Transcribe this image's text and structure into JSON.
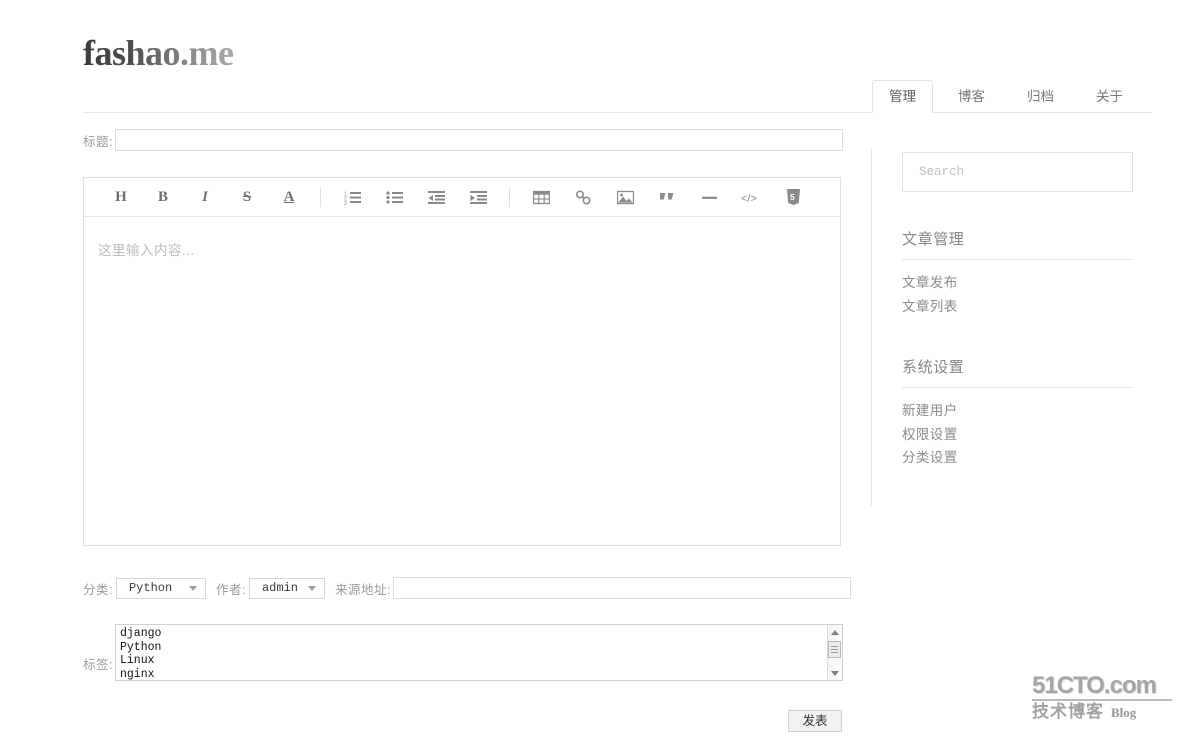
{
  "site": {
    "title": "fashao.me"
  },
  "nav": {
    "tabs": [
      {
        "label": "管理",
        "active": true
      },
      {
        "label": "博客",
        "active": false
      },
      {
        "label": "归档",
        "active": false
      },
      {
        "label": "关于",
        "active": false
      }
    ]
  },
  "form": {
    "title_label": "标题:",
    "title_value": "",
    "title_placeholder": "",
    "editor_placeholder": "这里输入内容...",
    "category_label": "分类:",
    "category_value": "Python",
    "author_label": "作者:",
    "author_value": "admin",
    "source_label": "来源地址:",
    "source_value": "",
    "source_placeholder": "",
    "tags_label": "标签:",
    "tags": [
      "django",
      "Python",
      "Linux",
      "nginx"
    ],
    "submit_label": "发表"
  },
  "toolbar": {
    "buttons": [
      {
        "name": "heading",
        "glyph": "H",
        "type": "letter"
      },
      {
        "name": "bold",
        "glyph": "B",
        "type": "letter"
      },
      {
        "name": "italic",
        "glyph": "I",
        "type": "letter-italic"
      },
      {
        "name": "strikethrough",
        "glyph": "S",
        "type": "letter-strike"
      },
      {
        "name": "underline",
        "glyph": "A",
        "type": "letter-underline"
      },
      {
        "name": "separator-1",
        "glyph": "",
        "type": "sep"
      },
      {
        "name": "ordered-list",
        "glyph": "",
        "type": "icon"
      },
      {
        "name": "unordered-list",
        "glyph": "",
        "type": "icon"
      },
      {
        "name": "outdent",
        "glyph": "",
        "type": "icon"
      },
      {
        "name": "indent",
        "glyph": "",
        "type": "icon"
      },
      {
        "name": "separator-2",
        "glyph": "",
        "type": "sep"
      },
      {
        "name": "table",
        "glyph": "",
        "type": "icon"
      },
      {
        "name": "link",
        "glyph": "",
        "type": "icon"
      },
      {
        "name": "image",
        "glyph": "",
        "type": "icon"
      },
      {
        "name": "quote",
        "glyph": "",
        "type": "icon"
      },
      {
        "name": "horizontal-rule",
        "glyph": "",
        "type": "icon"
      },
      {
        "name": "code",
        "glyph": "</>",
        "type": "icon"
      },
      {
        "name": "html5",
        "glyph": "",
        "type": "icon"
      }
    ]
  },
  "sidebar": {
    "search_placeholder": "Search",
    "search_value": "",
    "sections": [
      {
        "heading": "文章管理",
        "links": [
          "文章发布",
          "文章列表"
        ]
      },
      {
        "heading": "系统设置",
        "links": [
          "新建用户",
          "权限设置",
          "分类设置"
        ]
      }
    ]
  },
  "watermark": {
    "top": "51CTO.com",
    "cn": "技术博客",
    "blog": "Blog"
  },
  "colors": {
    "text": "#555555",
    "muted": "#9b9b9b",
    "border": "#e0e0e0",
    "accent": "#5b5b5b"
  }
}
